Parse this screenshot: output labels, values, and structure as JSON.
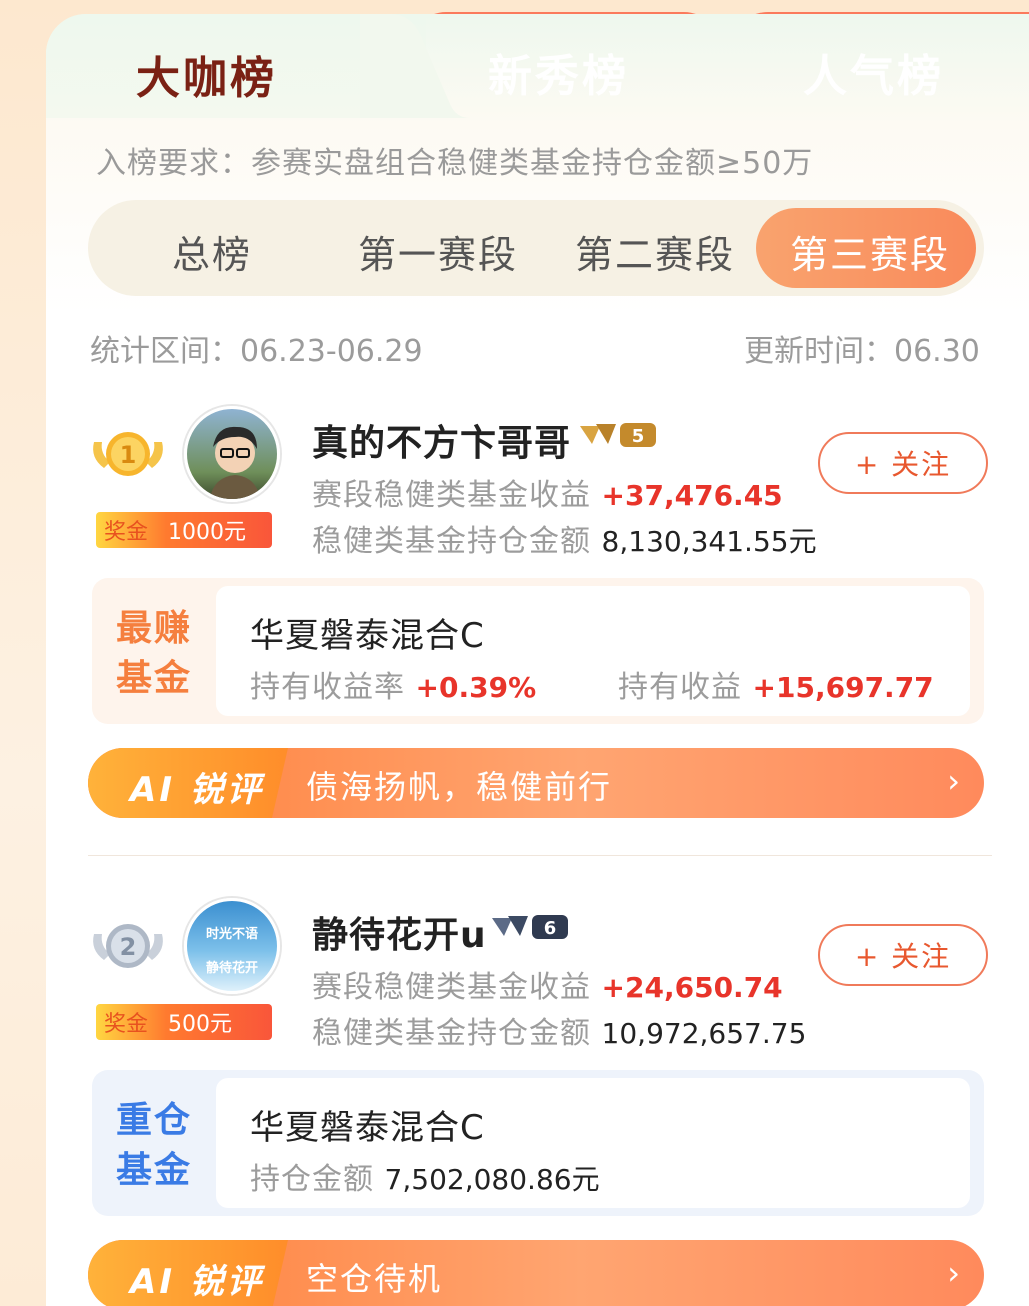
{
  "tabs": [
    {
      "label": "大咖榜",
      "active": true
    },
    {
      "label": "新秀榜",
      "active": false
    },
    {
      "label": "人气榜",
      "active": false
    }
  ],
  "requirement": "入榜要求：参赛实盘组合稳健类基金持仓金额≥50万",
  "segments": [
    {
      "label": "总榜",
      "active": false
    },
    {
      "label": "第一赛段",
      "active": false
    },
    {
      "label": "第二赛段",
      "active": false
    },
    {
      "label": "第三赛段",
      "active": true
    }
  ],
  "stats": {
    "period": "统计区间：06.23-06.29",
    "updated": "更新时间：06.30"
  },
  "colors": {
    "accent": "#f7634a",
    "gain_red": "#e8342a",
    "tab_active_text": "#7a2114"
  },
  "entries": [
    {
      "rank": "1",
      "name": "真的不方卞哥哥",
      "level": "5",
      "prize_label": "奖金",
      "prize_value": "1000元",
      "follow_label": "+ 关注",
      "gain_label": "赛段稳健类基金收益",
      "gain_value": "+37,476.45",
      "holding_label": "稳健类基金持仓金额",
      "holding_value": "8,130,341.55元",
      "fund_tag_line1": "最赚",
      "fund_tag_line2": "基金",
      "fund_name": "华夏磐泰混合C",
      "fund_rate_label": "持有收益率",
      "fund_rate_value": "+0.39%",
      "fund_profit_label": "持有收益",
      "fund_profit_value": "+15,697.77",
      "ai_label": "AI 锐评",
      "ai_text": "债海扬帆，稳健前行",
      "ai_chevron": "›"
    },
    {
      "rank": "2",
      "name": "静待花开u",
      "level": "6",
      "prize_label": "奖金",
      "prize_value": "500元",
      "follow_label": "+ 关注",
      "gain_label": "赛段稳健类基金收益",
      "gain_value": "+24,650.74",
      "holding_label": "稳健类基金持仓金额",
      "holding_value": "10,972,657.75",
      "avatar_text_1": "时光不语",
      "avatar_text_2": "静待花开",
      "fund_tag_line1": "重仓",
      "fund_tag_line2": "基金",
      "fund_name": "华夏磐泰混合C",
      "fund_amount_label": "持仓金额",
      "fund_amount_value": "7,502,080.86元",
      "ai_label": "AI 锐评",
      "ai_text": "空仓待机",
      "ai_chevron": "›"
    }
  ]
}
